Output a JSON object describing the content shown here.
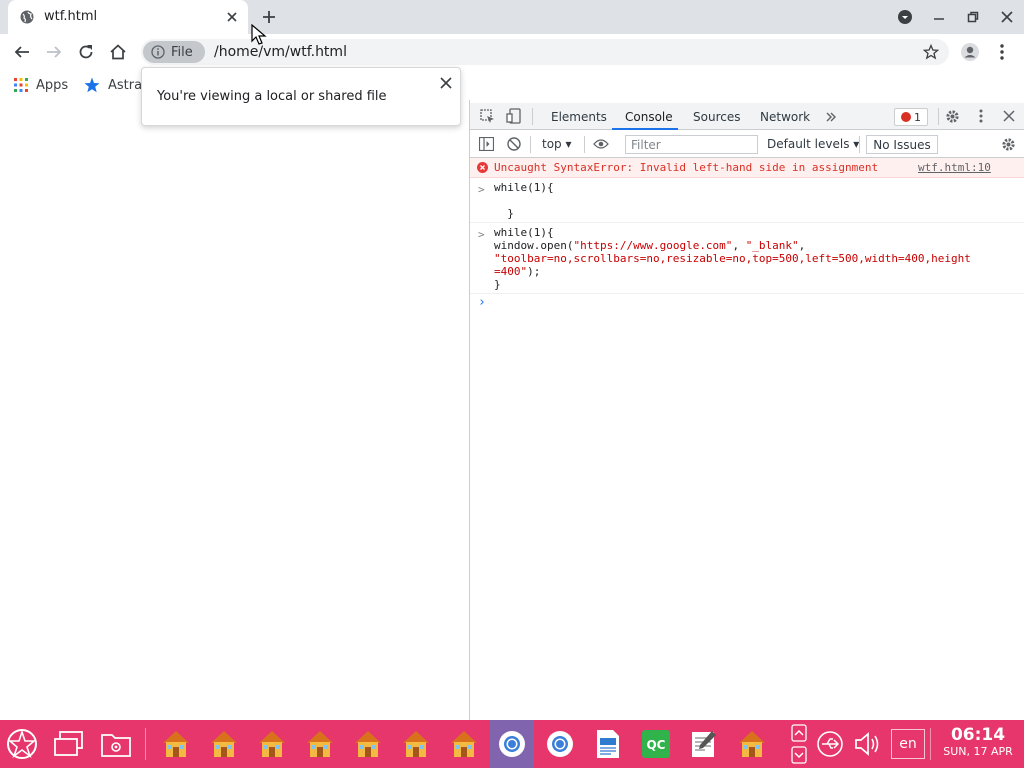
{
  "browser": {
    "tab": {
      "title": "wtf.html",
      "favicon": "globe-icon"
    },
    "new_tab_label": "+",
    "caption_buttons": [
      "profile-menu-icon",
      "minimize-icon",
      "restore-icon",
      "close-icon"
    ]
  },
  "toolbar": {
    "chip_label": "File",
    "url": "/home/vm/wtf.html"
  },
  "bookmarks": [
    {
      "label": "Apps",
      "icon": "apps-grid-icon"
    },
    {
      "label": "Astra",
      "icon": "star-bookmark-icon"
    }
  ],
  "bubble": {
    "message": "You're viewing a local or shared file"
  },
  "devtools": {
    "tabs": [
      "Elements",
      "Console",
      "Sources",
      "Network"
    ],
    "active_tab": "Console",
    "error_count": "1",
    "context": "top",
    "filter_placeholder": "Filter",
    "levels": "Default levels",
    "issues": "No Issues",
    "error": {
      "message": "Uncaught SyntaxError: Invalid left-hand side in assignment",
      "source": "wtf.html:10"
    },
    "entries": [
      {
        "code": "while(1){\n\n  }"
      },
      {
        "code": "while(1){\nwindow.open(\"https://www.google.com\", \"_blank\",\n\"toolbar=no,scrollbars=no,resizable=no,top=500,left=500,width=400,height\n=400\");\n}"
      }
    ]
  },
  "taskbar": {
    "lang": "en",
    "time": "06:14",
    "date": "SUN, 17 APR"
  },
  "colors": {
    "taskbar": "#e6366b",
    "accent": "#1a73e8",
    "error": "#d93025"
  }
}
